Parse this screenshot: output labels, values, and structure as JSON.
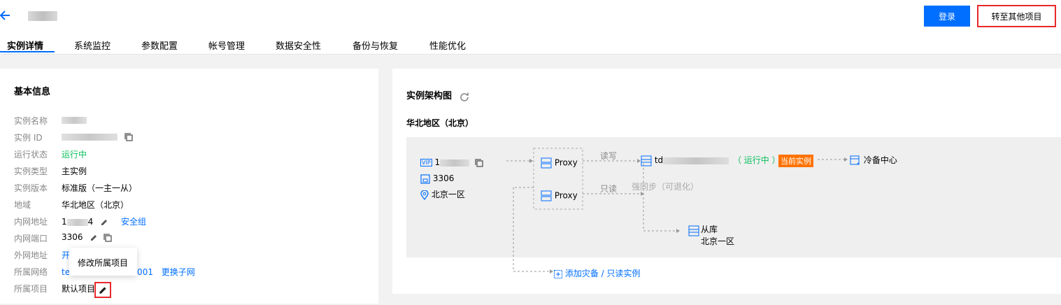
{
  "header": {
    "login_label": "登录",
    "transfer_label": "转至其他项目"
  },
  "tabs": [
    {
      "label": "实例详情"
    },
    {
      "label": "系统监控"
    },
    {
      "label": "参数配置"
    },
    {
      "label": "帐号管理"
    },
    {
      "label": "数据安全性"
    },
    {
      "label": "备份与恢复"
    },
    {
      "label": "性能优化"
    }
  ],
  "basic_info": {
    "title": "基本信息",
    "rows": [
      {
        "label": "实例名称"
      },
      {
        "label": "实例 ID"
      },
      {
        "label": "运行状态",
        "value": "运行中"
      },
      {
        "label": "实例类型",
        "value": "主实例"
      },
      {
        "label": "实例版本",
        "value": "标准版（一主一从）"
      },
      {
        "label": "地域",
        "value": "华北地区（北京）"
      },
      {
        "label": "内网地址",
        "value_prefix": "1",
        "value_suffix": "4",
        "link": "安全组"
      },
      {
        "label": "内网端口",
        "value": "3306"
      },
      {
        "label": "外网地址",
        "value": "开"
      },
      {
        "label": "所属网络",
        "value_prefix": "te",
        "value_suffix": "8-001",
        "link": "更换子网"
      },
      {
        "label": "所属项目",
        "value": "默认项目"
      }
    ],
    "tooltip": "修改所属项目"
  },
  "architecture": {
    "title": "实例架构图",
    "region": "华北地区（北京）",
    "vip_label": "VIP",
    "vip_prefix": "1",
    "port": "3306",
    "zone": "北京一区",
    "proxy1": "Proxy",
    "proxy2": "Proxy",
    "rw_label": "读写",
    "ro_label": "只读",
    "sync_label": "强同步（可退化）",
    "master_prefix": "td",
    "master_status": "（ 运行中 ）",
    "current_badge": "当前实例",
    "cold_backup": "冷备中心",
    "slave_label": "从库",
    "slave_zone": "北京一区",
    "add_label": "添加灾备 / 只读实例"
  },
  "colors": {
    "accent": "#006eff",
    "running": "#0abf5b",
    "badge": "#ff7200",
    "highlight": "#e8282b"
  }
}
